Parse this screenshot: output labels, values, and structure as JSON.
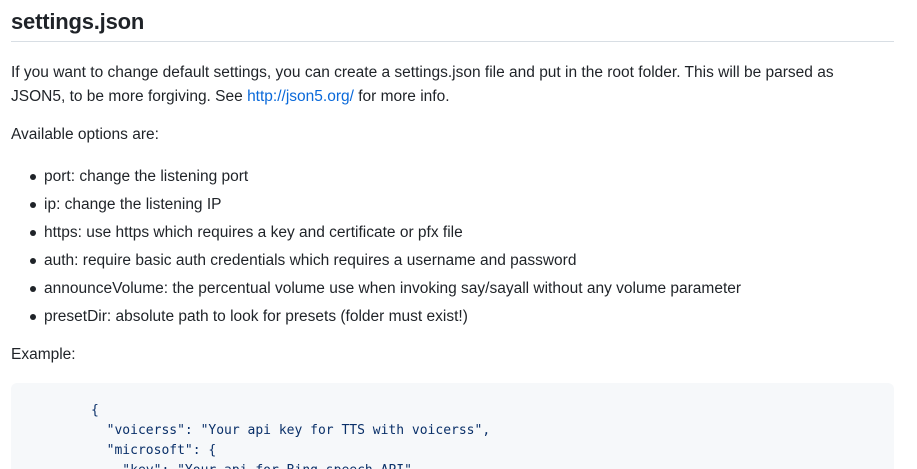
{
  "title": "settings.json",
  "intro": {
    "text_before_link": "If you want to change default settings, you can create a settings.json file and put in the root folder. This will be parsed as JSON5, to be more forgiving. See ",
    "link_text": "http://json5.org/",
    "text_after_link": " for more info."
  },
  "available_label": "Available options are:",
  "options": [
    "port: change the listening port",
    "ip: change the listening IP",
    "https: use https which requires a key and certificate or pfx file",
    "auth: require basic auth credentials which requires a username and password",
    "announceVolume: the percentual volume use when invoking say/sayall without any volume parameter",
    "presetDir: absolute path to look for presets (folder must exist!)"
  ],
  "example_label": "Example:",
  "code_lines": [
    "{",
    "  \"voicerss\": \"Your api key for TTS with voicerss\",",
    "  \"microsoft\": {",
    "    \"key\": \"Your api for Bing speech API\","
  ]
}
